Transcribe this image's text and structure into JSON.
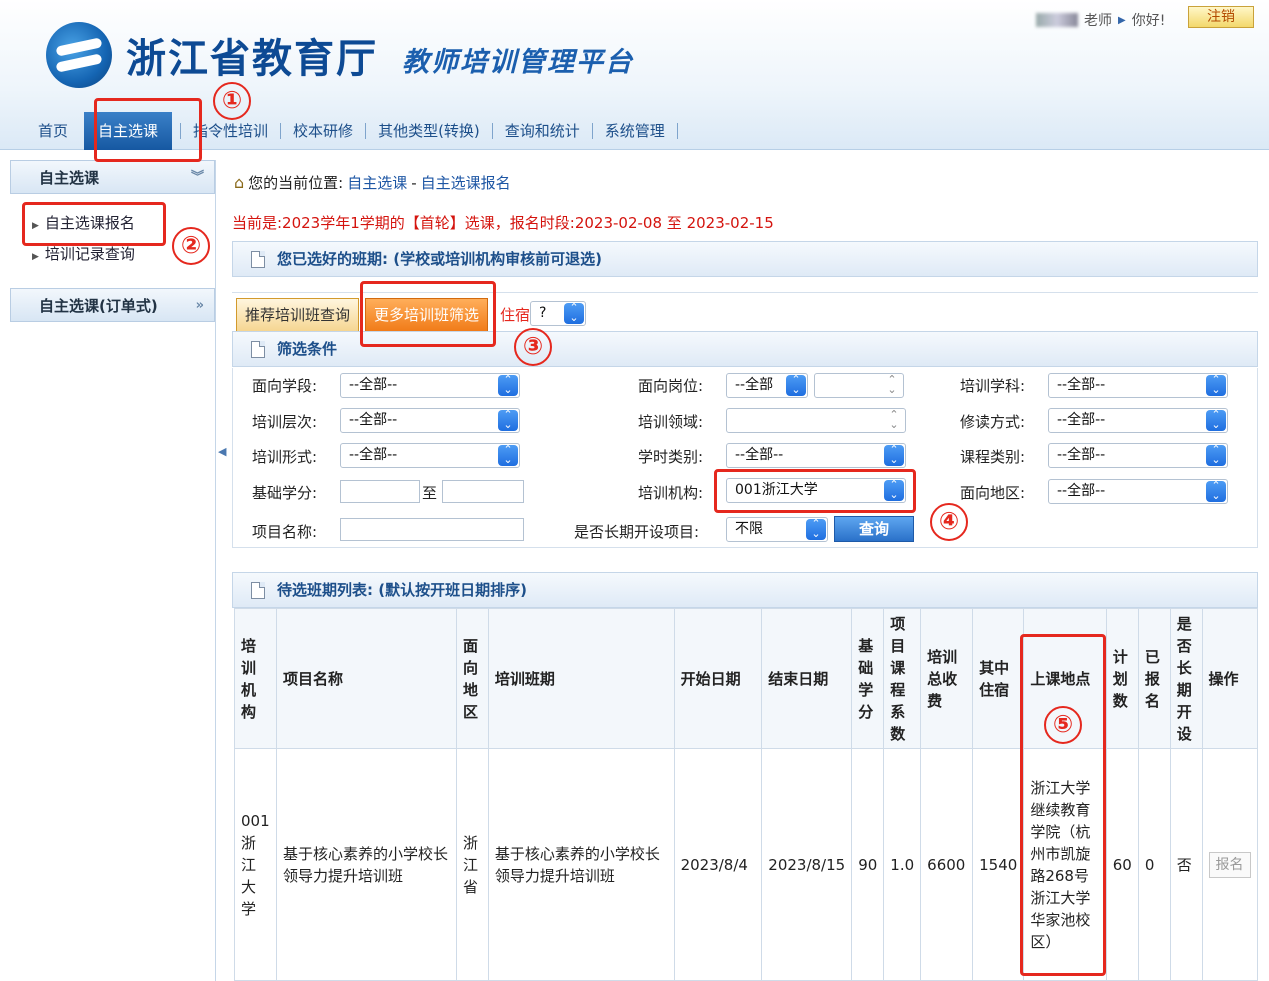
{
  "header": {
    "site_name": "浙江省教育厅",
    "platform_name": "教师培训管理平台",
    "user_role": "老师",
    "greeting": "你好!",
    "logout_label": "注销"
  },
  "nav": {
    "items": [
      {
        "label": "首页"
      },
      {
        "label": "自主选课"
      },
      {
        "label": "指令性培训"
      },
      {
        "label": "校本研修"
      },
      {
        "label": "其他类型(转换)"
      },
      {
        "label": "查询和统计"
      },
      {
        "label": "系统管理"
      }
    ],
    "active_index": 1
  },
  "sidebar": {
    "group1_title": "自主选课",
    "items": [
      {
        "label": "自主选课报名"
      },
      {
        "label": "培训记录查询"
      }
    ],
    "group2_title": "自主选课(订单式)"
  },
  "breadcrumb": {
    "prefix": "您的当前位置:",
    "level1": "自主选课",
    "sep": "-",
    "level2": "自主选课报名"
  },
  "period": {
    "text_before": "当前是:2023学年1学期的【首轮】选课，报名时段:",
    "start": "2023-02-08",
    "mid": "至",
    "end": "2023-02-15"
  },
  "selected_section": {
    "title": "您已选好的班期:",
    "note": "(学校或培训机构审核前可退选)"
  },
  "tabs": {
    "recommend": "推荐培训班查询",
    "more": "更多培训班筛选",
    "lodging_label": "住宿",
    "lodging_value": "?"
  },
  "filter": {
    "title": "筛选条件",
    "fields": {
      "stage_label": "面向学段:",
      "stage_value": "--全部--",
      "post_label": "面向岗位:",
      "post_value": "--全部",
      "subject_label": "培训学科:",
      "subject_value": "--全部--",
      "level_label": "培训层次:",
      "level_value": "--全部--",
      "domain_label": "培训领域:",
      "domain_value": "",
      "mode_label": "修读方式:",
      "mode_value": "--全部--",
      "form_label": "培训形式:",
      "form_value": "--全部--",
      "hours_label": "学时类别:",
      "hours_value": "--全部--",
      "course_label": "课程类别:",
      "course_value": "--全部--",
      "credit_label": "基础学分:",
      "credit_to": "至",
      "org_label": "培训机构:",
      "org_value": "001浙江大学",
      "region_label": "面向地区:",
      "region_value": "--全部--",
      "project_label": "项目名称:",
      "longterm_label": "是否长期开设项目:",
      "longterm_value": "不限",
      "query_label": "查询"
    }
  },
  "list_section": {
    "title": "待选班期列表:",
    "note": "(默认按开班日期排序)"
  },
  "table": {
    "headers": [
      "培训机构",
      "项目名称",
      "面向地区",
      "培训班期",
      "开始日期",
      "结束日期",
      "基础学分",
      "项目课程系数",
      "培训总收费",
      "其中住宿",
      "上课地点",
      "计划数",
      "已报名",
      "是否长期开设",
      "操作"
    ],
    "rows": [
      {
        "org": "001浙江大学",
        "project": "基于核心素养的小学校长领导力提升培训班",
        "region": "浙江省",
        "class_name": "基于核心素养的小学校长领导力提升培训班",
        "start": "2023/8/4",
        "end": "2023/8/15",
        "credit": "90",
        "coef": "1.0",
        "fee": "6600",
        "lodging": "1540",
        "location": "浙江大学继续教育学院（杭州市凯旋路268号浙江大学华家池校区）",
        "plan": "60",
        "enrolled": "0",
        "longterm": "否",
        "action": "报名"
      }
    ]
  },
  "annotations": [
    "①",
    "②",
    "③",
    "④",
    "⑤"
  ],
  "colors": {
    "annotation": "#e5281e",
    "brand": "#1658a2",
    "accent_orange": "#f07a17"
  }
}
